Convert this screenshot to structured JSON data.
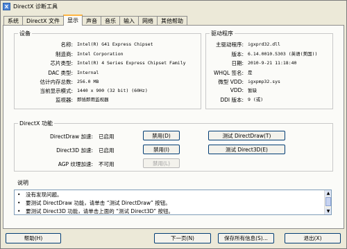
{
  "window": {
    "title": "DirectX 诊断工具",
    "icon": "directx-icon"
  },
  "tabs": [
    "系统",
    "DirectX 文件",
    "显示",
    "声音",
    "音乐",
    "输入",
    "网络",
    "其他帮助"
  ],
  "active_tab": "显示",
  "device": {
    "title": "设备",
    "rows": [
      {
        "label": "名称:",
        "value": "Intel(R) G41 Express Chipset"
      },
      {
        "label": "制造商:",
        "value": "Intel Corporation"
      },
      {
        "label": "芯片类型:",
        "value": "Intel(R) 4 Series Express Chipset Family"
      },
      {
        "label": "DAC 类型:",
        "value": "Internal"
      },
      {
        "label": "估计内存总数:",
        "value": "256.0 MB"
      },
      {
        "label": "当前显示模式:",
        "value": "1440 x 900 (32 bit) (60Hz)"
      },
      {
        "label": "监视器:",
        "value": "即插即用监视器"
      }
    ]
  },
  "driver": {
    "title": "驱动程序",
    "rows": [
      {
        "label": "主驱动程序:",
        "value": "igxprd32.dll"
      },
      {
        "label": "版本:",
        "value": "6.14.0010.5303 (英语(美国))"
      },
      {
        "label": "日期:",
        "value": "2010-9-21 11:18:40"
      },
      {
        "label": "WHQL 签名:",
        "value": "是"
      },
      {
        "label": "微型 VDD:",
        "value": "igxpmp32.sys"
      },
      {
        "label": "VDD:",
        "value": "暂缺"
      },
      {
        "label": "DDI 版本:",
        "value": "9 (或)"
      }
    ]
  },
  "directx": {
    "title": "DirectX 功能",
    "rows": [
      {
        "label": "DirectDraw 加速:",
        "state": "已启用",
        "disable": "禁用(D)",
        "test": "测试 DirectDraw(T)"
      },
      {
        "label": "Direct3D 加速:",
        "state": "已启用",
        "disable": "禁用(I)",
        "test": "测试 Direct3D(E)"
      },
      {
        "label": "AGP 纹理加速:",
        "state": "不可用",
        "disable": "禁用(L)"
      }
    ]
  },
  "notes": {
    "title": "说明",
    "items": [
      "没有发现问题。",
      "要测试 DirectDraw 功能，请单击 “测试 DirectDraw” 按钮。",
      "要测试 Direct3D 功能，请单击上面的 “测试 Direct3D” 按钮。"
    ]
  },
  "footer": {
    "help": "帮助(H)",
    "next": "下一页(N)",
    "save": "保存所有信息(S)...",
    "exit": "退出(X)"
  }
}
